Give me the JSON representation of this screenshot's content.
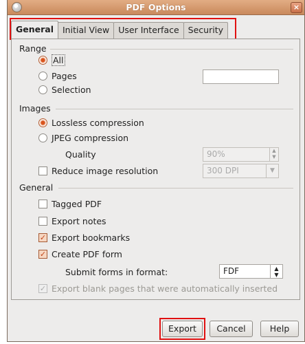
{
  "window": {
    "title": "PDF Options",
    "close_glyph": "×"
  },
  "tabs": [
    {
      "label": "General",
      "active": true
    },
    {
      "label": "Initial View",
      "active": false
    },
    {
      "label": "User Interface",
      "active": false
    },
    {
      "label": "Security",
      "active": false
    }
  ],
  "range": {
    "heading": "Range",
    "options": [
      {
        "label": "All",
        "selected": true
      },
      {
        "label": "Pages",
        "selected": false
      },
      {
        "label": "Selection",
        "selected": false
      }
    ],
    "pages_value": ""
  },
  "images": {
    "heading": "Images",
    "lossless_label": "Lossless compression",
    "jpeg_label": "JPEG compression",
    "quality_label": "Quality",
    "quality_value": "90%",
    "reduce_label": "Reduce image resolution",
    "resolution_value": "300 DPI"
  },
  "general": {
    "heading": "General",
    "tagged_pdf": "Tagged PDF",
    "export_notes": "Export notes",
    "export_bookmarks": "Export bookmarks",
    "create_pdf_form": "Create PDF form",
    "submit_forms_label": "Submit forms in format:",
    "submit_format_value": "FDF",
    "export_blank_pages": "Export blank pages that were automatically inserted"
  },
  "buttons": {
    "export": "Export",
    "cancel": "Cancel",
    "help": "Help"
  },
  "icons": {
    "close": "close-icon",
    "app": "app-icon",
    "combo": "chevron-down-icon",
    "spin": "spin-arrows-icon",
    "check": "checkmark-icon"
  },
  "colors": {
    "titlebar": "#c9895c",
    "radio_on": "#d9541e",
    "highlight": "#e01010"
  }
}
